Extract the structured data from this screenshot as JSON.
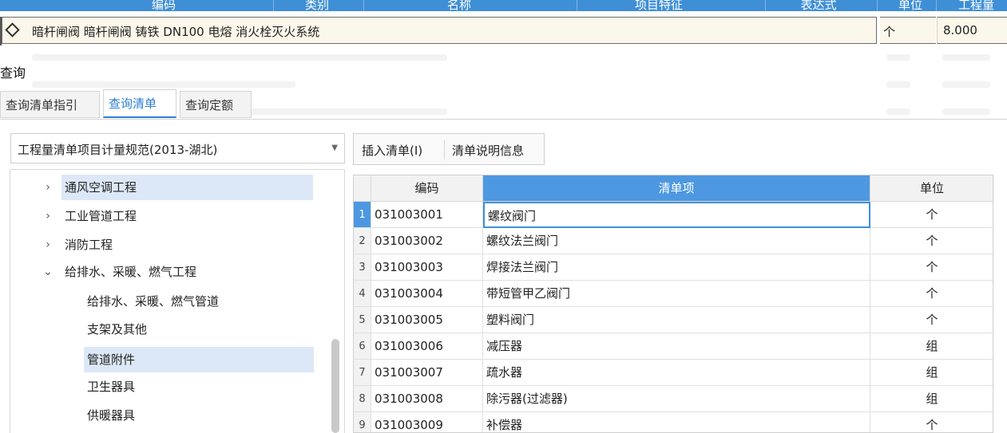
{
  "top_grid": {
    "columns": [
      "编码",
      "类别",
      "名称",
      "项目特征",
      "表达式",
      "单位",
      "工程量"
    ],
    "row": {
      "description": "暗杆闸阀 暗杆闸阀 铸铁 DN100 电熔 消火栓灭火系统",
      "unit": "个",
      "quantity": "8.000"
    }
  },
  "panel": {
    "title": "查询",
    "tabs": [
      "查询清单指引",
      "查询清单",
      "查询定额"
    ],
    "active_tab": "查询清单",
    "spec_select": "工程量清单项目计量规范(2013-湖北)",
    "buttons": {
      "insert": "插入清单(I)",
      "info": "清单说明信息"
    }
  },
  "tree": {
    "items": [
      {
        "label": "通风空调工程",
        "expander": "›"
      },
      {
        "label": "工业管道工程",
        "expander": "›"
      },
      {
        "label": "消防工程",
        "expander": "›"
      },
      {
        "label": "给排水、采暖、燃气工程",
        "expander": "⌄"
      },
      {
        "label": "给排水、采暖、燃气管道"
      },
      {
        "label": "支架及其他"
      },
      {
        "label": "管道附件"
      },
      {
        "label": "卫生器具"
      },
      {
        "label": "供暖器具"
      }
    ]
  },
  "table": {
    "headers": {
      "code": "编码",
      "item": "清单项",
      "unit": "单位"
    },
    "rows": [
      {
        "n": "1",
        "code": "031003001",
        "name": "螺纹阀门",
        "unit": "个"
      },
      {
        "n": "2",
        "code": "031003002",
        "name": "螺纹法兰阀门",
        "unit": "个"
      },
      {
        "n": "3",
        "code": "031003003",
        "name": "焊接法兰阀门",
        "unit": "个"
      },
      {
        "n": "4",
        "code": "031003004",
        "name": "带短管甲乙阀门",
        "unit": "个"
      },
      {
        "n": "5",
        "code": "031003005",
        "name": "塑料阀门",
        "unit": "个"
      },
      {
        "n": "6",
        "code": "031003006",
        "name": "减压器",
        "unit": "组"
      },
      {
        "n": "7",
        "code": "031003007",
        "name": "疏水器",
        "unit": "组"
      },
      {
        "n": "8",
        "code": "031003008",
        "name": "除污器(过滤器)",
        "unit": "组"
      },
      {
        "n": "9",
        "code": "031003009",
        "name": "补偿器",
        "unit": "个"
      }
    ]
  },
  "colors": {
    "accent": "#3f8fd6",
    "selection": "#dce8f7",
    "row_highlight": "#fbf7ea"
  },
  "icons": {
    "row_marker": "diamond-icon",
    "dropdown": "caret-down-icon",
    "tree_collapsed": "chevron-right-icon",
    "tree_expanded": "chevron-down-icon"
  }
}
